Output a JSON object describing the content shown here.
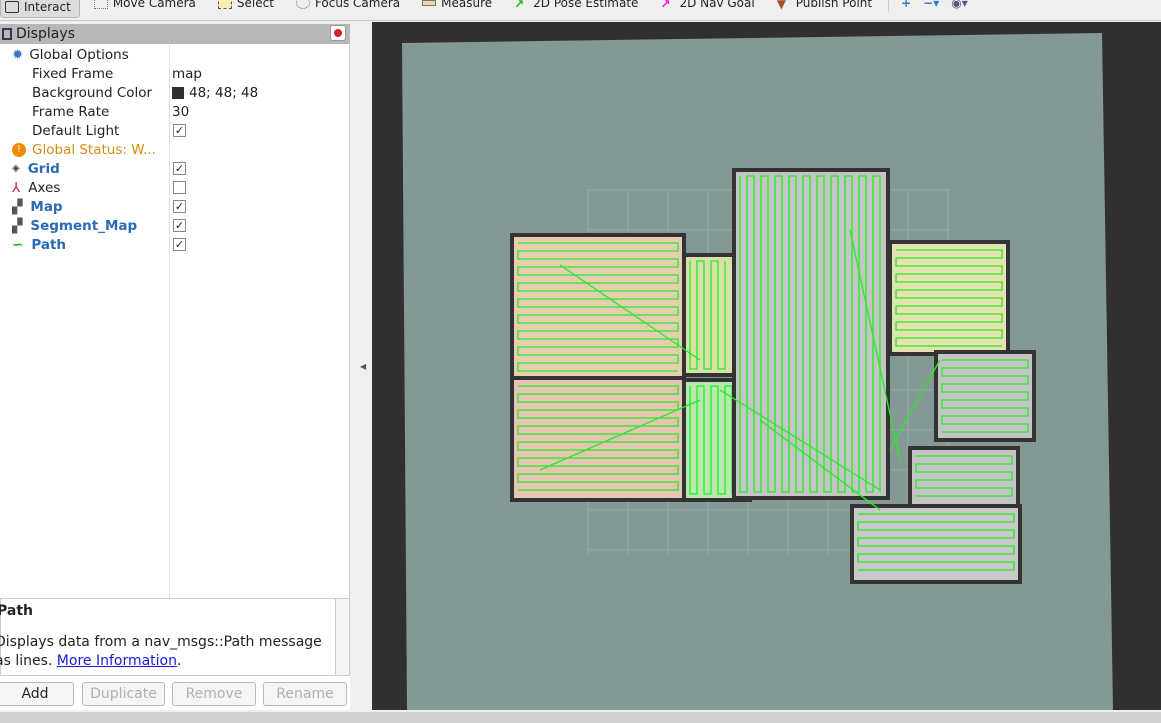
{
  "toolbar": {
    "tools": [
      {
        "label": "Interact",
        "icon": "interact-icon"
      },
      {
        "label": "Move Camera",
        "icon": "move-camera-icon"
      },
      {
        "label": "Select",
        "icon": "select-icon"
      },
      {
        "label": "Focus Camera",
        "icon": "focus-camera-icon"
      },
      {
        "label": "Measure",
        "icon": "ruler-icon"
      },
      {
        "label": "2D Pose Estimate",
        "icon": "green-arrow-icon"
      },
      {
        "label": "2D Nav Goal",
        "icon": "magenta-arrow-icon"
      },
      {
        "label": "Publish Point",
        "icon": "map-pin-icon"
      }
    ]
  },
  "displays": {
    "title": "Displays",
    "global_options": "Global Options",
    "fixed_frame_label": "Fixed Frame",
    "fixed_frame": "map",
    "bg_label": "Background Color",
    "bg": "48; 48; 48",
    "bg_color": "#303030",
    "fps_label": "Frame Rate",
    "fps": "30",
    "light_label": "Default Light",
    "light": true,
    "global_status": "Global Status: W...",
    "items": [
      {
        "label": "Grid",
        "checked": true
      },
      {
        "label": "Axes",
        "checked": false
      },
      {
        "label": "Map",
        "checked": true
      },
      {
        "label": "Segment_Map",
        "checked": true
      },
      {
        "label": "Path",
        "checked": true
      }
    ]
  },
  "description": {
    "title": "Path",
    "text": "Displays data from a nav_msgs::Path message as lines. ",
    "link": "More Information",
    "end": "."
  },
  "buttons": {
    "add": "Add",
    "duplicate": "Duplicate",
    "remove": "Remove",
    "rename": "Rename"
  },
  "colors": {
    "map_bg": "#849996",
    "path": "#22ee22",
    "wall": "#333333"
  }
}
